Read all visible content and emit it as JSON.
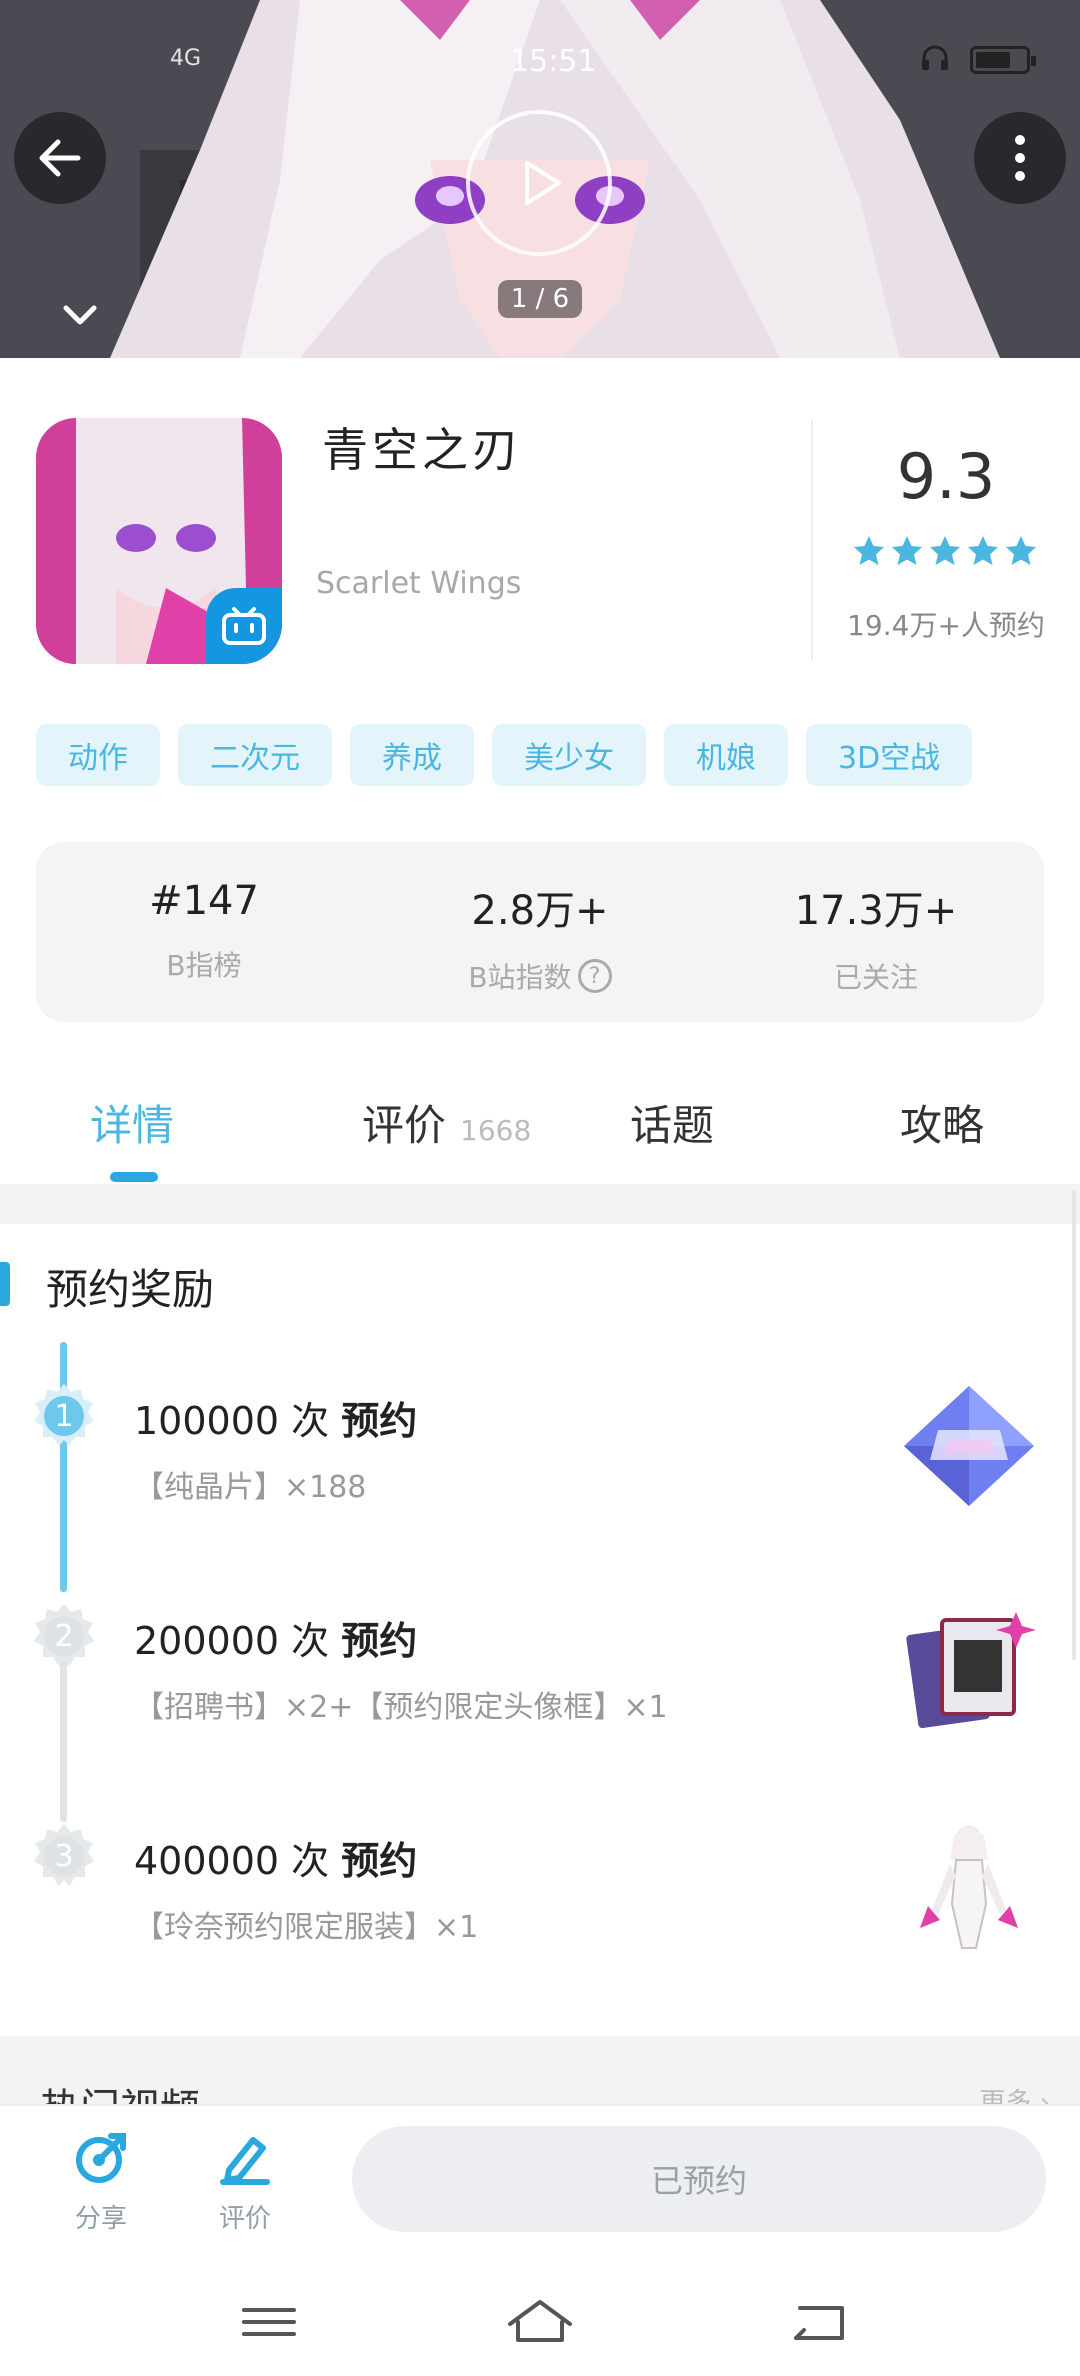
{
  "status_bar": {
    "time": "15:51",
    "signal": "4G"
  },
  "hero": {
    "counter": "1 / 6"
  },
  "app": {
    "name": "青空之刃",
    "subtitle": "Scarlet Wings",
    "score": "9.3",
    "rating_stars": 5,
    "reservations": "19.4万+人预约"
  },
  "tags": [
    "动作",
    "二次元",
    "养成",
    "美少女",
    "机娘",
    "3D空战"
  ],
  "stats": [
    {
      "value": "#147",
      "label": "B指榜"
    },
    {
      "value": "2.8万+",
      "label": "B站指数"
    },
    {
      "value": "17.3万+",
      "label": "已关注"
    }
  ],
  "tabs": [
    {
      "label": "详情",
      "active": true
    },
    {
      "label": "评价",
      "count": "1668"
    },
    {
      "label": "话题"
    },
    {
      "label": "攻略"
    }
  ],
  "rewards": {
    "title": "预约奖励",
    "items": [
      {
        "step": "1",
        "count": "100000 次",
        "suffix": "预约",
        "desc": "【纯晶片】×188",
        "reached": true
      },
      {
        "step": "2",
        "count": "200000 次",
        "suffix": "预约",
        "desc": "【招聘书】×2+【预约限定头像框】×1",
        "reached": false
      },
      {
        "step": "3",
        "count": "400000 次",
        "suffix": "预约",
        "desc": "【玲奈预约限定服装】×1",
        "reached": false
      }
    ]
  },
  "hot_videos": {
    "title": "热门视频",
    "more": "更多"
  },
  "bottom_bar": {
    "share_label": "分享",
    "review_label": "评价",
    "reserved_label": "已预约"
  },
  "colors": {
    "accent": "#29a8e0",
    "tag_bg": "#e3f5fb",
    "tag_text": "#4bb6e0"
  }
}
